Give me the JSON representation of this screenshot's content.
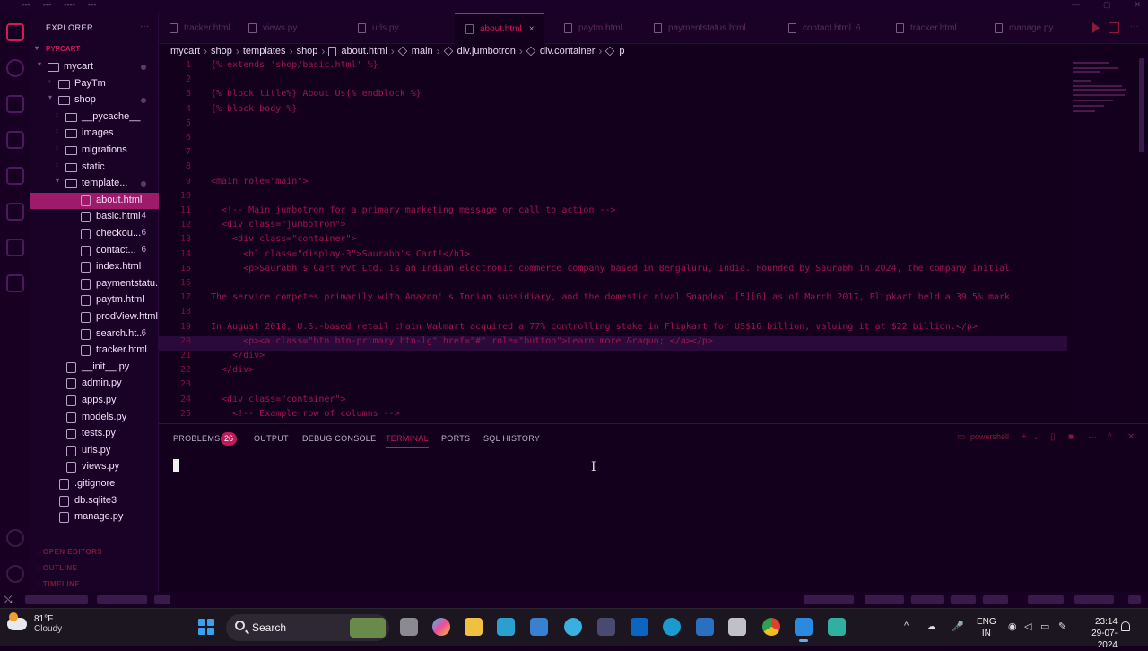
{
  "explorer": {
    "title": "EXPLORER",
    "root": "PYPCART",
    "tree": [
      {
        "label": "mycart",
        "type": "folder",
        "open": true,
        "depth": 1,
        "dot": true
      },
      {
        "label": "PayTm",
        "type": "folder",
        "open": false,
        "depth": 2
      },
      {
        "label": "shop",
        "type": "folder",
        "open": true,
        "depth": 2,
        "dot": true
      },
      {
        "label": "__pycache__",
        "type": "folder",
        "open": false,
        "depth": 3
      },
      {
        "label": "images",
        "type": "folder",
        "open": false,
        "depth": 3
      },
      {
        "label": "migrations",
        "type": "folder",
        "open": false,
        "depth": 3
      },
      {
        "label": "static",
        "type": "folder",
        "open": false,
        "depth": 3
      },
      {
        "label": "template...",
        "type": "folder",
        "open": true,
        "depth": 3,
        "dot": true
      },
      {
        "label": "about.html",
        "type": "file",
        "depth": 4,
        "active": true
      },
      {
        "label": "basic.html",
        "type": "file",
        "depth": 4,
        "badge": "4"
      },
      {
        "label": "checkou...",
        "type": "file",
        "depth": 4,
        "badge": "6"
      },
      {
        "label": "contact...",
        "type": "file",
        "depth": 4,
        "badge": "6"
      },
      {
        "label": "index.html",
        "type": "file",
        "depth": 4
      },
      {
        "label": "paymentstatu...",
        "type": "file",
        "depth": 4
      },
      {
        "label": "paytm.html",
        "type": "file",
        "depth": 4
      },
      {
        "label": "prodView.html",
        "type": "file",
        "depth": 4
      },
      {
        "label": "search.ht...",
        "type": "file",
        "depth": 4,
        "badge": "6"
      },
      {
        "label": "tracker.html",
        "type": "file",
        "depth": 4
      },
      {
        "label": "__init__.py",
        "type": "file",
        "depth": 3
      },
      {
        "label": "admin.py",
        "type": "file",
        "depth": 3
      },
      {
        "label": "apps.py",
        "type": "file",
        "depth": 3
      },
      {
        "label": "models.py",
        "type": "file",
        "depth": 3
      },
      {
        "label": "tests.py",
        "type": "file",
        "depth": 3
      },
      {
        "label": "urls.py",
        "type": "file",
        "depth": 3
      },
      {
        "label": "views.py",
        "type": "file",
        "depth": 3
      },
      {
        "label": ".gitignore",
        "type": "file",
        "depth": 2
      },
      {
        "label": "db.sqlite3",
        "type": "file",
        "depth": 2
      },
      {
        "label": "manage.py",
        "type": "file",
        "depth": 2
      }
    ],
    "sections": [
      "OPEN EDITORS",
      "OUTLINE",
      "TIMELINE"
    ]
  },
  "tabs": [
    {
      "label": "tracker.html"
    },
    {
      "label": "views.py"
    },
    {
      "label": "urls.py"
    },
    {
      "label": "about.html",
      "active": true
    },
    {
      "label": "paytm.html"
    },
    {
      "label": "paymentstatus.html"
    },
    {
      "label": "contact.html",
      "count": "6"
    },
    {
      "label": "tracker.html"
    },
    {
      "label": "manage.py"
    }
  ],
  "breadcrumb": [
    "mycart",
    "shop",
    "templates",
    "shop",
    "about.html",
    "main",
    "div.jumbotron",
    "div.container",
    "p"
  ],
  "editor": {
    "highlighted_line": 20,
    "lines": [
      {
        "n": "1",
        "code": "{% extends 'shop/basic.html' %}"
      },
      {
        "n": "2",
        "code": ""
      },
      {
        "n": "3",
        "code": "{% block title%} About Us{% endblock %}"
      },
      {
        "n": "4",
        "code": "{% block body %}"
      },
      {
        "n": "5",
        "code": ""
      },
      {
        "n": "6",
        "code": ""
      },
      {
        "n": "7",
        "code": ""
      },
      {
        "n": "8",
        "code": ""
      },
      {
        "n": "9",
        "code": "<main role=\"main\">"
      },
      {
        "n": "10",
        "code": ""
      },
      {
        "n": "11",
        "code": "  <!-- Main jumbotron for a primary marketing message or call to action -->"
      },
      {
        "n": "12",
        "code": "  <div class=\"jumbotron\">"
      },
      {
        "n": "13",
        "code": "    <div class=\"container\">"
      },
      {
        "n": "14",
        "code": "      <h1 class=\"display-3\">Saurabh's Cart!</h1>"
      },
      {
        "n": "15",
        "code": "      <p>Saurabh's Cart Pvt Ltd. is an Indian electronic commerce company based in Bengaluru, India. Founded by Saurabh in 2024, the company initial"
      },
      {
        "n": "16",
        "code": ""
      },
      {
        "n": "17",
        "code": "The service competes primarily with Amazon' s Indian subsidiary, and the domestic rival Snapdeal.[5][6] as of March 2017, Flipkart held a 39.5% mark"
      },
      {
        "n": "18",
        "code": ""
      },
      {
        "n": "19",
        "code": "In August 2018, U.S.-based retail chain Walmart acquired a 77% controlling stake in Flipkart for US$16 billion, valuing it at $22 billion.</p>"
      },
      {
        "n": "20",
        "code": "      <p><a class=\"btn btn-primary btn-lg\" href=\"#\" role=\"button\">Learn more &raquo; </a></p>"
      },
      {
        "n": "21",
        "code": "    </div>"
      },
      {
        "n": "22",
        "code": "  </div>"
      },
      {
        "n": "23",
        "code": ""
      },
      {
        "n": "24",
        "code": "  <div class=\"container\">"
      },
      {
        "n": "25",
        "code": "    <!-- Example row of columns -->"
      }
    ]
  },
  "panel": {
    "tabs": [
      "PROBLEMS",
      "OUTPUT",
      "DEBUG CONSOLE",
      "TERMINAL",
      "PORTS",
      "SQL HISTORY"
    ],
    "problems_count": "26",
    "active_tab": "TERMINAL",
    "shell": "powershell"
  },
  "taskbar": {
    "temperature": "81°F",
    "condition": "Cloudy",
    "search_label": "Search",
    "language": "ENG",
    "region": "IN",
    "time": "23:14",
    "date": "29-07-2024"
  },
  "colors": {
    "accent": "#d01a5a",
    "active_file_bg": "#9e1a6a",
    "background": "#12001c"
  }
}
